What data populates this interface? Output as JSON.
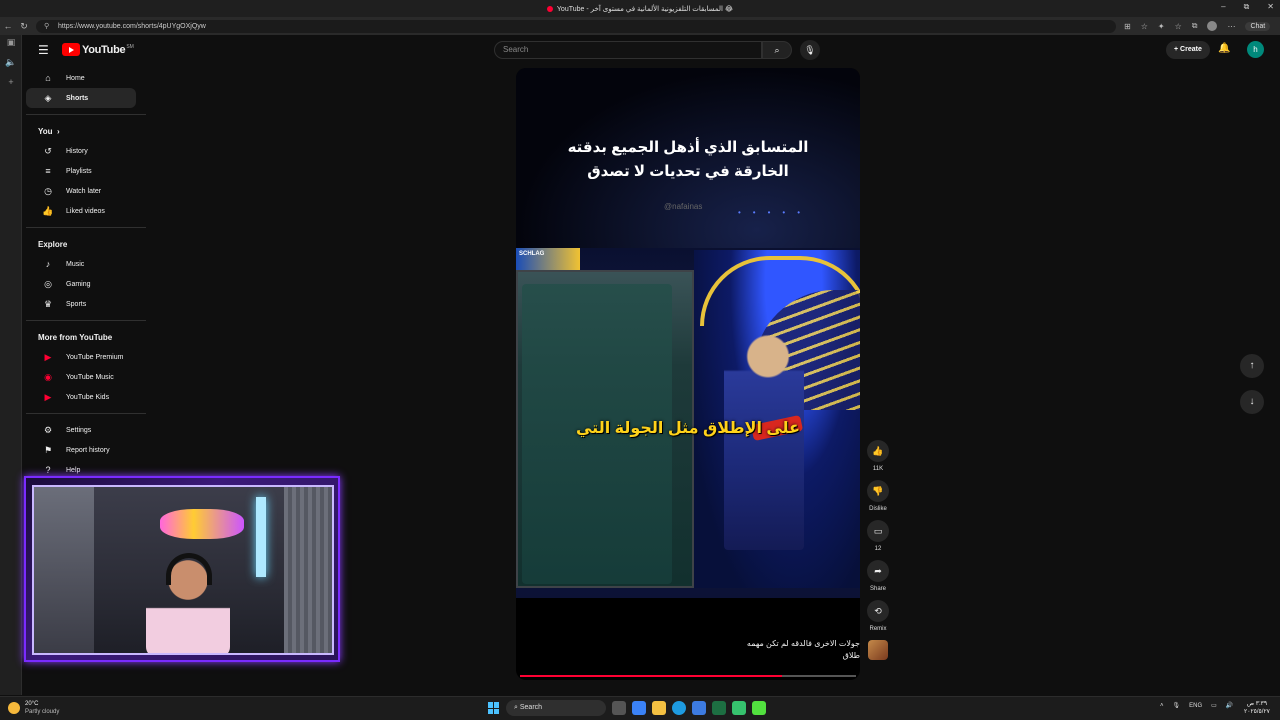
{
  "browser": {
    "tab_title": "YouTube - المسابقات التلفزيونية الألمانية في مستوى آخر 😂",
    "url": "https://www.youtube.com/shorts/4pUYgOXjQyw",
    "chat_label": "Chat",
    "window_controls": [
      "–",
      "⧉",
      "✕"
    ]
  },
  "header": {
    "logo_text": "YouTube",
    "region": "SM",
    "search_placeholder": "Search",
    "create_label": "Create",
    "user_initial": "h"
  },
  "sidebar": {
    "main": [
      {
        "label": "Home",
        "icon": "home-icon"
      },
      {
        "label": "Shorts",
        "icon": "shorts-icon",
        "active": true
      }
    ],
    "you_title": "You",
    "you": [
      {
        "label": "History",
        "icon": "history-icon"
      },
      {
        "label": "Playlists",
        "icon": "playlists-icon"
      },
      {
        "label": "Watch later",
        "icon": "clock-icon"
      },
      {
        "label": "Liked videos",
        "icon": "thumb-up-icon"
      }
    ],
    "explore_title": "Explore",
    "explore": [
      {
        "label": "Music",
        "icon": "music-icon"
      },
      {
        "label": "Gaming",
        "icon": "gamepad-icon"
      },
      {
        "label": "Sports",
        "icon": "trophy-icon"
      }
    ],
    "more_title": "More from YouTube",
    "more": [
      {
        "label": "YouTube Premium",
        "icon": "youtube-premium-icon"
      },
      {
        "label": "YouTube Music",
        "icon": "youtube-music-icon"
      },
      {
        "label": "YouTube Kids",
        "icon": "youtube-kids-icon"
      }
    ],
    "footer": [
      {
        "label": "Settings",
        "icon": "gear-icon"
      },
      {
        "label": "Report history",
        "icon": "flag-icon"
      },
      {
        "label": "Help",
        "icon": "help-icon"
      }
    ]
  },
  "short": {
    "title_line1": "المتسابق الذي أذهل الجميع بدقته",
    "title_line2": "الخارقة في تحديات لا تصدق",
    "handle": "@nafainas",
    "stage_sign": "SCHLAG",
    "caption": "على الإطلاق مثل الجولة التي",
    "bottom_line1": "جولات الاخرى فالدقه لم تكن مهمه",
    "bottom_line2": "طلاق",
    "progress": 0.78
  },
  "actions": {
    "like_count": "11K",
    "dislike_label": "Dislike",
    "comment_count": "12",
    "share_label": "Share",
    "remix_label": "Remix"
  },
  "taskbar": {
    "temperature": "20°C",
    "weather": "Partly cloudy",
    "search_label": "Search",
    "language": "ENG",
    "time": "٣:٣٩ ص",
    "date": "٢٠٢٥/٥/٢٧"
  }
}
